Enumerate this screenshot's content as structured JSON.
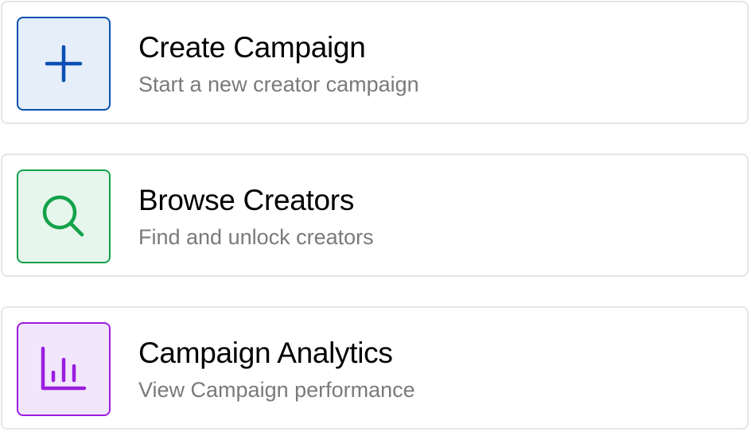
{
  "actions": [
    {
      "title": "Create Campaign",
      "subtitle": "Start a new creator campaign",
      "icon": "plus-icon",
      "accent": "#0a4fb3",
      "background": "#e6eef9"
    },
    {
      "title": "Browse Creators",
      "subtitle": "Find and unlock creators",
      "icon": "search-icon",
      "accent": "#13a24a",
      "background": "#e6f6ec"
    },
    {
      "title": "Campaign Analytics",
      "subtitle": "View Campaign performance",
      "icon": "bar-chart-icon",
      "accent": "#9b1de0",
      "background": "#f2e6fc"
    }
  ]
}
